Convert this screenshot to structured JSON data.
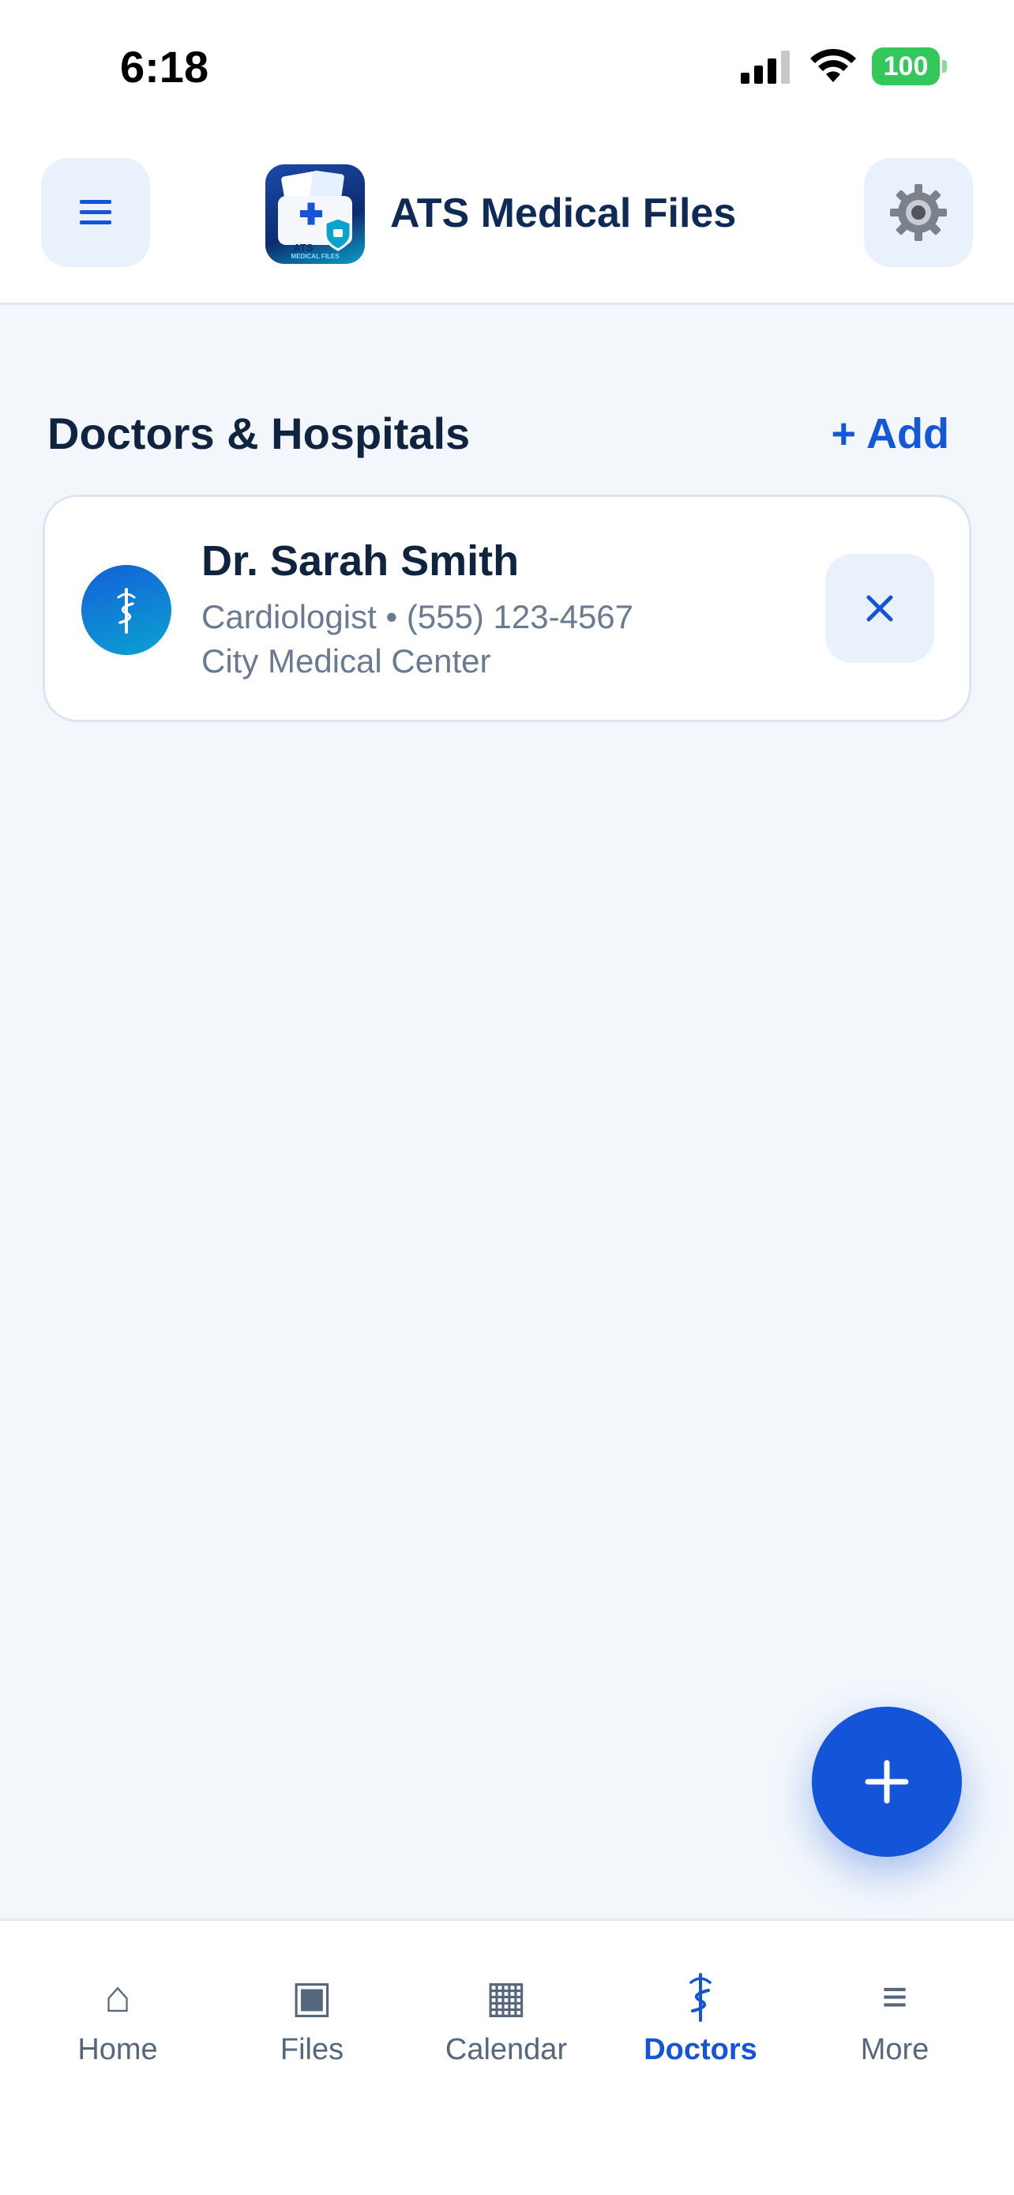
{
  "status_bar": {
    "time": "6:18",
    "battery": "100",
    "signal_icon": "cellular-signal-icon",
    "wifi_icon": "wifi-icon"
  },
  "header": {
    "title": "ATS Medical Files",
    "logo_text": "ATS",
    "logo_subtext": "MEDICAL FILES",
    "menu_icon": "hamburger-menu-icon",
    "settings_icon": "gear-icon"
  },
  "section": {
    "title": "Doctors & Hospitals",
    "add_label": "+ Add"
  },
  "doctors": [
    {
      "name": "Dr. Sarah Smith",
      "meta": "Cardiologist • (555) 123-4567",
      "hospital": "City Medical Center",
      "icon": "caduceus-icon"
    }
  ],
  "fab": {
    "icon": "plus-icon"
  },
  "bottom_nav": {
    "items": [
      {
        "label": "Home",
        "icon": "⌂",
        "icon_name": "home-icon"
      },
      {
        "label": "Files",
        "icon": "▣",
        "icon_name": "files-icon"
      },
      {
        "label": "Calendar",
        "icon": "▦",
        "icon_name": "calendar-icon"
      },
      {
        "label": "Doctors",
        "icon": "⚕",
        "icon_name": "doctors-icon"
      },
      {
        "label": "More",
        "icon": "≡",
        "icon_name": "more-icon"
      }
    ],
    "active_index": 3
  },
  "colors": {
    "accent": "#1454d8",
    "title_text": "#0f2a56",
    "background": "#f3f7fc",
    "battery": "#34c759"
  }
}
